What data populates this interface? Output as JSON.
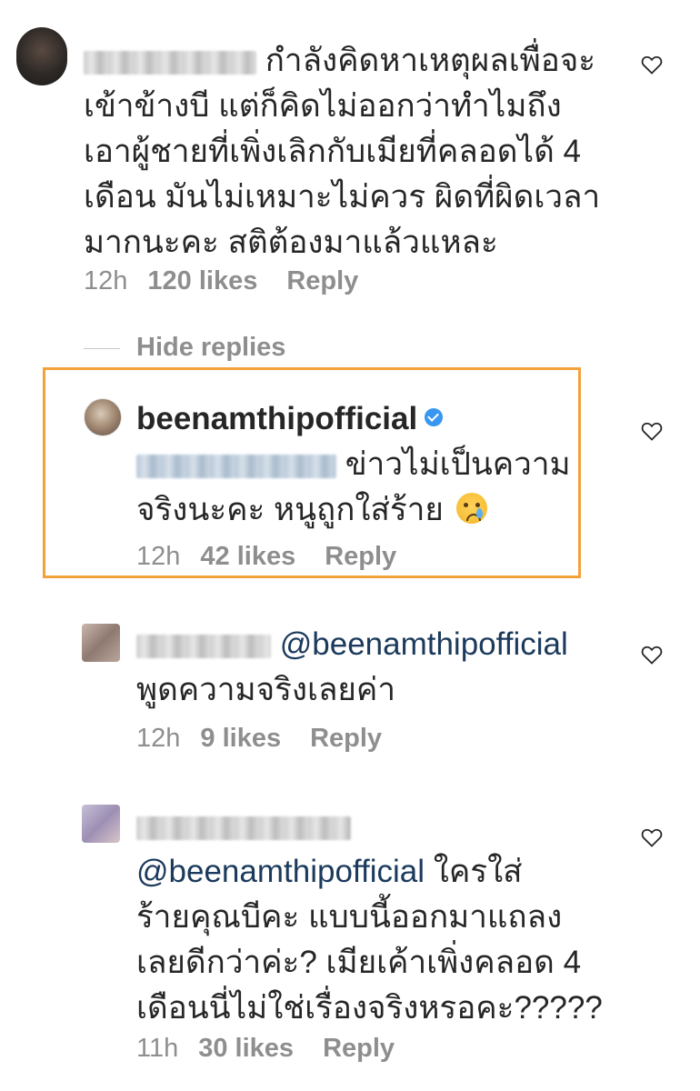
{
  "comments": [
    {
      "text_lines": [
        "กำลังคิดหาเหตุผลเพื่อจะ",
        "เข้าข้างบี แต่ก็คิดไม่ออกว่าทำไมถึง",
        "เอาผู้ชายที่เพิ่งเลิกกับเมียที่คลอดได้ 4",
        "เดือน มันไม่เหมาะไม่ควร ผิดที่ผิดเวลา",
        "มากนะคะ สติต้องมาแล้วแหละ"
      ],
      "time": "12h",
      "likes": "120 likes",
      "reply": "Reply"
    },
    {
      "username": "beenamthipofficial",
      "text_lines": [
        "ข่าวไม่เป็นความ",
        "จริงนะคะ หนูถูกใส่ร้าย"
      ],
      "emoji": "crying-face",
      "time": "12h",
      "likes": "42 likes",
      "reply": "Reply"
    },
    {
      "mention": "@beenamthipofficial",
      "text_lines": [
        "พูดความจริงเลยค่า"
      ],
      "time": "12h",
      "likes": "9 likes",
      "reply": "Reply"
    },
    {
      "mention": "@beenamthipofficial",
      "text_lines": [
        "ใครใส่",
        "ร้ายคุณบีคะ แบบนี้ออกมาแถลง",
        "เลยดีกว่าค่ะ? เมียเค้าเพิ่งคลอด 4",
        "เดือนนี่ไม่ใช่เรื่องจริงหรอคะ?????"
      ],
      "time": "11h",
      "likes": "30 likes",
      "reply": "Reply"
    }
  ],
  "hide_replies": "Hide replies",
  "colors": {
    "highlight": "#f2a23a",
    "mention": "#1b3a5c",
    "meta": "#8e8e8e",
    "verified": "#3897f0"
  },
  "icons": {
    "like": "heart-outline-icon",
    "verified": "verified-badge-icon"
  }
}
